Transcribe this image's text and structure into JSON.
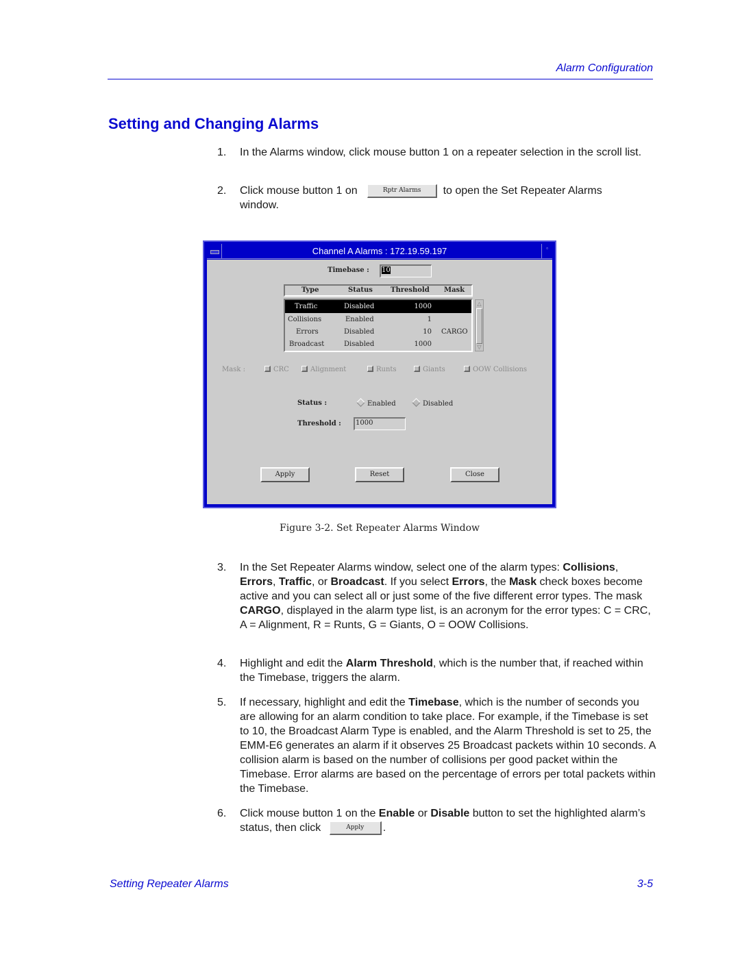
{
  "header": {
    "running_title": "Alarm Configuration"
  },
  "section_title": "Setting and Changing Alarms",
  "steps": [
    {
      "num": "1.",
      "text": "In the Alarms window, click mouse button 1 on a repeater selection in the scroll list."
    },
    {
      "num": "2.",
      "pre": "Click mouse button 1 on",
      "button": "Rptr Alarms",
      "post": "to open the Set Repeater Alarms",
      "post2": "window."
    },
    {
      "num": "3.",
      "t1": "In the Set Repeater Alarms window, select one of the alarm types:",
      "b1": "Collisions",
      "t2": ", ",
      "b2": "Errors",
      "t3": ", ",
      "b3": "Traffic",
      "t4": ", or ",
      "b4": "Broadcast",
      "t5": ". If you select ",
      "b5": "Errors",
      "t6": ", the ",
      "b6": "Mask",
      "t7": " check boxes become active and you can select all or just some of the five different error types. The mask ",
      "b7": "CARGO",
      "t8": ", displayed in the alarm type list, is an acronym for the error types: C = CRC, A = Alignment, R = Runts, G = Giants, O = OOW Collisions."
    },
    {
      "num": "4.",
      "t1": "Highlight and edit the ",
      "b1": "Alarm Threshold",
      "t2": ", which is the number that, if reached within the Timebase, triggers the alarm."
    },
    {
      "num": "5.",
      "t1": "If necessary, highlight and edit the ",
      "b1": "Timebase",
      "t2": ", which is the number of seconds you are allowing for an alarm condition to take place. For example, if the Timebase is set to 10, the Broadcast Alarm Type is enabled, and the Alarm Threshold is set to 25, the EMM-E6 generates an alarm if it observes 25 Broadcast packets within 10 seconds. A collision alarm is based on the number of collisions per good packet within the Timebase. Error alarms are based on the percentage of errors per total packets within the Timebase."
    },
    {
      "num": "6.",
      "t1": "Click mouse button 1 on the ",
      "b1": "Enable",
      "t2": " or ",
      "b2": "Disable",
      "t3": " button to set the highlighted alarm’s status, then click",
      "button": "Apply",
      "t4": "."
    }
  ],
  "dialog": {
    "title": "Channel A Alarms : 172.19.59.197",
    "timebase_label": "Timebase :",
    "timebase_value": "10",
    "columns": [
      "Type",
      "Status",
      "Threshold",
      "Mask"
    ],
    "rows": [
      {
        "type": "Traffic",
        "status": "Disabled",
        "threshold": "1000",
        "mask": "",
        "selected": true
      },
      {
        "type": "Collisions",
        "status": "Enabled",
        "threshold": "1",
        "mask": ""
      },
      {
        "type": "Errors",
        "status": "Disabled",
        "threshold": "10",
        "mask": "CARGO"
      },
      {
        "type": "Broadcast",
        "status": "Disabled",
        "threshold": "1000",
        "mask": ""
      }
    ],
    "mask_label": "Mask :",
    "mask_options": [
      "CRC",
      "Alignment",
      "Runts",
      "Giants",
      "OOW Collisions"
    ],
    "status_label": "Status :",
    "status_options": [
      "Enabled",
      "Disabled"
    ],
    "status_selected": "Disabled",
    "threshold_label": "Threshold :",
    "threshold_value": "1000",
    "buttons": {
      "apply": "Apply",
      "reset": "Reset",
      "close": "Close"
    }
  },
  "caption": "Figure 3-2.  Set Repeater Alarms Window",
  "footer": {
    "section": "Setting Repeater Alarms",
    "page": "3-5"
  }
}
